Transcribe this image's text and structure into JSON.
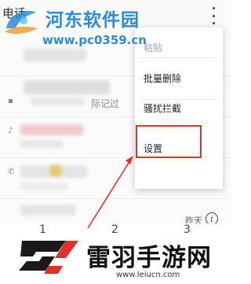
{
  "header": {
    "title": "电话"
  },
  "watermark_top": {
    "name": "河东软件园",
    "url": "www.pc0359.cn"
  },
  "call_list": {
    "partial_note": "际记过",
    "rows": [
      {
        "time": ""
      },
      {
        "time": ""
      },
      {
        "time": ""
      },
      {
        "time": "昨天"
      },
      {
        "time": "昨天"
      }
    ]
  },
  "menu": {
    "items": [
      {
        "label": "粘贴"
      },
      {
        "label": "批量删除"
      },
      {
        "label": "骚扰拦截"
      },
      {
        "label": "设置"
      }
    ],
    "highlight_color": "#e0302e"
  },
  "dialpad": {
    "digits": [
      "1",
      "2",
      "3"
    ]
  },
  "watermark_bottom": {
    "name": "雷羽手游网",
    "url": "www.leiucn.com"
  },
  "colors": {
    "accent_blue": "#2a8bd6",
    "highlight_red": "#e0302e"
  }
}
